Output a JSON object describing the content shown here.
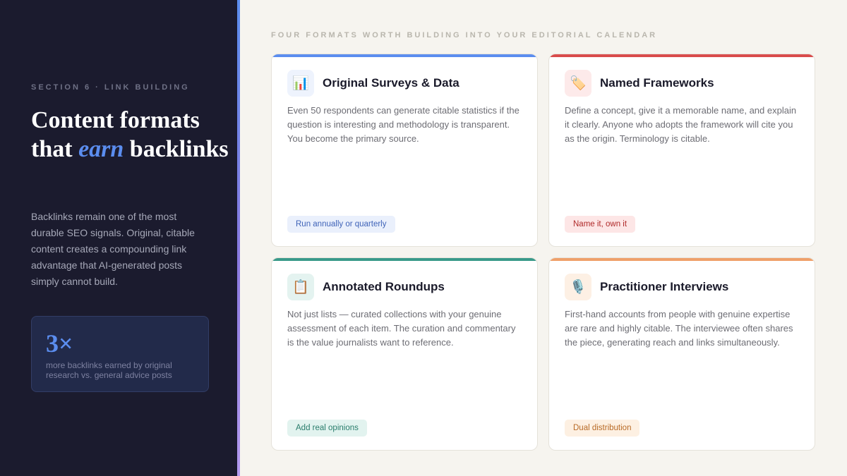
{
  "sidebar": {
    "eyebrow": "SECTION 6 · LINK BUILDING",
    "headline_part1": "Content formats that ",
    "headline_em": "earn",
    "headline_part2": " backlinks",
    "lead": "Backlinks remain one of the most durable SEO signals. Original, citable content creates a compounding link advantage that AI-generated posts simply cannot build.",
    "stat": {
      "value": "3×",
      "caption": "more backlinks earned by original research vs. general advice posts"
    }
  },
  "grid": {
    "title": "FOUR FORMATS WORTH BUILDING INTO YOUR EDITORIAL CALENDAR"
  },
  "colors": {
    "blue": "#5b8def",
    "red": "#d94c4c",
    "teal": "#3a9a8a",
    "orange": "#efa06a"
  },
  "cards": [
    {
      "icon": "bar-chart-icon",
      "glyph": "📊",
      "title": "Original Surveys & Data",
      "body": "Even 50 respondents can generate citable statistics if the question is interesting and methodology is transparent. You become the primary source.",
      "tag": "Run annually or quarterly"
    },
    {
      "icon": "label-tag-icon",
      "glyph": "🏷️",
      "title": "Named Frameworks",
      "body": "Define a concept, give it a memorable name, and explain it clearly. Anyone who adopts the framework will cite you as the origin. Terminology is citable.",
      "tag": "Name it, own it"
    },
    {
      "icon": "clipboard-icon",
      "glyph": "📋",
      "title": "Annotated Roundups",
      "body": "Not just lists — curated collections with your genuine assessment of each item. The curation and commentary is the value journalists want to reference.",
      "tag": "Add real opinions"
    },
    {
      "icon": "microphone-icon",
      "glyph": "🎙️",
      "title": "Practitioner Interviews",
      "body": "First-hand accounts from people with genuine expertise are rare and highly citable. The interviewee often shares the piece, generating reach and links simultaneously.",
      "tag": "Dual distribution"
    }
  ]
}
